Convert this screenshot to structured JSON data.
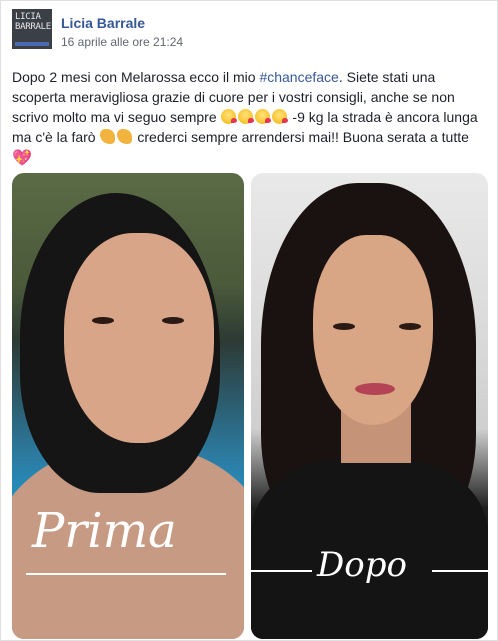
{
  "author": {
    "name": "Licia Barrale",
    "logo_lines": [
      "LICIA",
      "BARRALE"
    ]
  },
  "timestamp": "16 aprile alle ore 21:24",
  "post": {
    "text_part1": "Dopo 2 mesi con Melarossa ecco il mio ",
    "hashtag": "#chanceface",
    "text_part2": ". Siete stati una scoperta meravigliosa grazie di cuore per i vostri consigli, anche se non scrivo molto ma vi seguo sempre ",
    "text_part3": " -9 kg la strada è ancora lunga ma c'è la farò ",
    "text_part4": " crederci sempre arrendersi mai!! Buona serata a tutte ",
    "emojis": {
      "kiss": "kissing-face-emoji",
      "muscle": "flexed-biceps-emoji",
      "heart": "sparkling-heart-emoji"
    }
  },
  "photo": {
    "before_caption": "Prima",
    "after_caption": "Dopo"
  },
  "colors": {
    "link": "#365899",
    "text": "#1d2129",
    "meta": "#616770"
  }
}
